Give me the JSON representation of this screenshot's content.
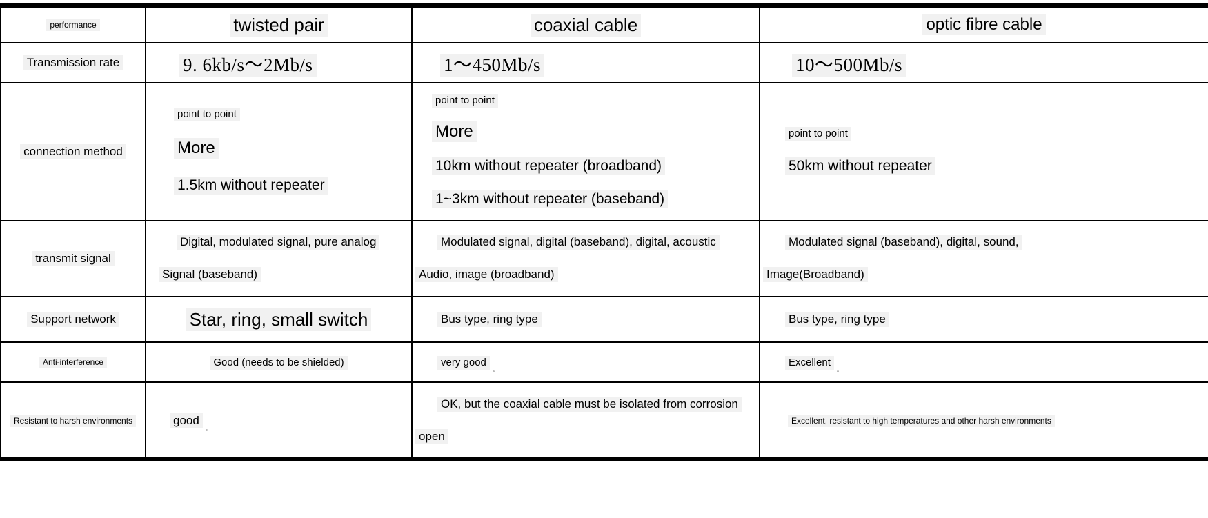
{
  "table": {
    "columns": [
      {
        "key": "performance",
        "label": "performance"
      },
      {
        "key": "twisted_pair",
        "label": "twisted pair"
      },
      {
        "key": "coaxial_cable",
        "label": "coaxial cable"
      },
      {
        "key": "optic_fibre_cable",
        "label": "optic fibre cable"
      }
    ],
    "rows": [
      {
        "name": "transmission-rate",
        "label": "Transmission rate",
        "twisted_pair": {
          "lines": [
            "9. 6kb/s～2Mb/s"
          ]
        },
        "coaxial_cable": {
          "lines": [
            "1～450Mb/s"
          ]
        },
        "optic_fibre_cable": {
          "lines": [
            "10～500Mb/s"
          ]
        }
      },
      {
        "name": "connection-method",
        "label": "connection method",
        "twisted_pair": {
          "lines": [
            "point to point",
            "More",
            "1.5km without repeater"
          ]
        },
        "coaxial_cable": {
          "lines": [
            "point to point",
            "More",
            "10km without repeater (broadband)",
            "1~3km without repeater (baseband)"
          ]
        },
        "optic_fibre_cable": {
          "lines": [
            "point to point",
            "50km without repeater"
          ]
        }
      },
      {
        "name": "transmit-signal",
        "label": "transmit signal",
        "twisted_pair": {
          "lines": [
            "Digital, modulated signal, pure analog",
            "Signal (baseband)"
          ]
        },
        "coaxial_cable": {
          "lines": [
            "Modulated signal, digital (baseband), digital, acoustic",
            "Audio, image (broadband)"
          ]
        },
        "optic_fibre_cable": {
          "lines": [
            "Modulated signal (baseband), digital, sound,",
            "Image(Broadband)"
          ]
        }
      },
      {
        "name": "support-network",
        "label": "Support network",
        "twisted_pair": {
          "lines": [
            "Star, ring, small switch"
          ]
        },
        "coaxial_cable": {
          "lines": [
            "Bus type, ring type"
          ]
        },
        "optic_fibre_cable": {
          "lines": [
            "Bus type, ring type"
          ]
        }
      },
      {
        "name": "anti-interference",
        "label": "Anti-interference",
        "twisted_pair": {
          "lines": [
            "Good (needs to be shielded)"
          ]
        },
        "coaxial_cable": {
          "lines": [
            "very good"
          ]
        },
        "optic_fibre_cable": {
          "lines": [
            "Excellent"
          ]
        }
      },
      {
        "name": "resistant-to-harsh-environments",
        "label": "Resistant to harsh environments",
        "twisted_pair": {
          "lines": [
            "good"
          ]
        },
        "coaxial_cable": {
          "lines": [
            "OK, but the coaxial cable must be isolated from corrosion",
            "open"
          ]
        },
        "optic_fibre_cable": {
          "lines": [
            "Excellent, resistant to high temperatures and other harsh environments"
          ]
        }
      }
    ]
  },
  "colors": {
    "rule": "#000000",
    "text": "#000000",
    "highlight": "#f1f1f1",
    "background": "#ffffff"
  }
}
